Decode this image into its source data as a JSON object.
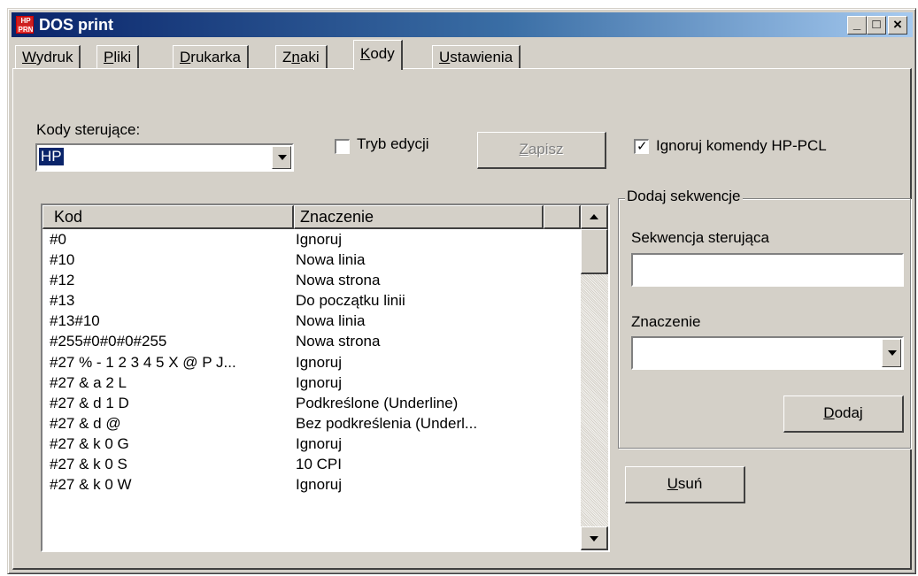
{
  "window": {
    "title": "DOS print",
    "icon_name": "dos-print-app-icon",
    "icon_top": "HP",
    "icon_bot": "PRN",
    "minimize": "_",
    "maximize": "□",
    "close": "×"
  },
  "tabs": [
    {
      "label": "Wydruk",
      "mnemonic": "W"
    },
    {
      "label": "Pliki",
      "mnemonic": "P"
    },
    {
      "label": "Drukarka",
      "mnemonic": "D"
    },
    {
      "label": "Znaki",
      "mnemonic": "n"
    },
    {
      "label": "Kody",
      "mnemonic": "K",
      "active": true
    },
    {
      "label": "Ustawienia",
      "mnemonic": "U"
    }
  ],
  "codes": {
    "label": "Kody sterujące:",
    "selected": "HP"
  },
  "edit_mode": {
    "label": "Tryb edycji",
    "checked": false
  },
  "save_button": {
    "label": "Zapisz",
    "mnemonic": "Z",
    "enabled": false
  },
  "ignore_hp": {
    "label": "Ignoruj komendy HP-PCL",
    "checked": true
  },
  "table": {
    "columns": [
      "Kod",
      "Znaczenie"
    ],
    "rows": [
      [
        "#0",
        "Ignoruj"
      ],
      [
        "#10",
        "Nowa linia"
      ],
      [
        "#12",
        "Nowa strona"
      ],
      [
        "#13",
        "Do początku linii"
      ],
      [
        "#13#10",
        "Nowa linia"
      ],
      [
        "#255#0#0#0#255",
        "Nowa strona"
      ],
      [
        "#27 % - 1 2 3 4 5 X @ P J...",
        "Ignoruj"
      ],
      [
        "#27 & a 2 L",
        "Ignoruj"
      ],
      [
        "#27 & d 1 D",
        "Podkreślone (Underline)"
      ],
      [
        "#27 & d @",
        "Bez podkreślenia (Underl..."
      ],
      [
        "#27 & k 0 G",
        "Ignoruj"
      ],
      [
        "#27 & k 0 S",
        "10 CPI"
      ],
      [
        "#27 & k 0 W",
        "Ignoruj"
      ]
    ]
  },
  "add_group": {
    "title": "Dodaj sekwencje",
    "sequence_label": "Sekwencja sterująca",
    "sequence_value": "",
    "meaning_label": "Znaczenie",
    "meaning_value": "",
    "add_button": "Dodaj",
    "add_mnemonic": "D"
  },
  "delete_button": {
    "label": "Usuń",
    "mnemonic": "U"
  },
  "colors": {
    "face": "#d4d0c8",
    "title_start": "#0a246a",
    "title_end": "#a6caf0",
    "selection": "#0a246a"
  }
}
